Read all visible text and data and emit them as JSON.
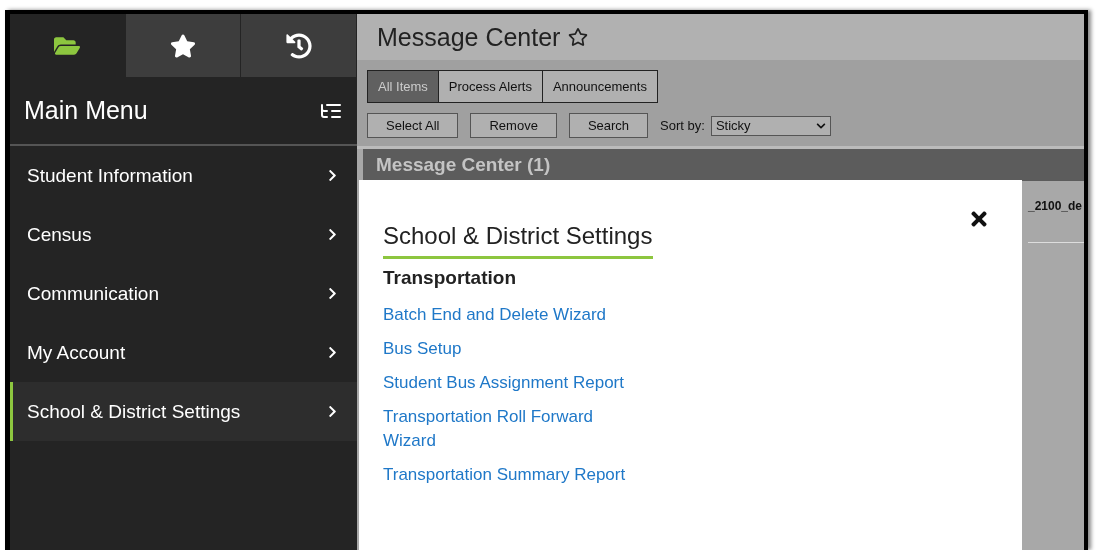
{
  "sidebar": {
    "tabs": [
      {
        "kind": "folder",
        "selected": true
      },
      {
        "kind": "star",
        "selected": false
      },
      {
        "kind": "history",
        "selected": false
      }
    ],
    "title": "Main Menu",
    "items": [
      {
        "label": "Student Information",
        "selected": false
      },
      {
        "label": "Census",
        "selected": false
      },
      {
        "label": "Communication",
        "selected": false
      },
      {
        "label": "My Account",
        "selected": false
      },
      {
        "label": "School & District Settings",
        "selected": true
      }
    ]
  },
  "main": {
    "title": "Message Center",
    "tabs": [
      {
        "label": "All Items",
        "selected": true
      },
      {
        "label": "Process Alerts",
        "selected": false
      },
      {
        "label": "Announcements",
        "selected": false
      }
    ],
    "buttons": [
      "Select All",
      "Remove",
      "Search"
    ],
    "sort_label": "Sort by:",
    "sort_value": "Sticky",
    "section_title": "Message Center (1)",
    "row_text": "_2100_de"
  },
  "popup": {
    "title": "School & District Settings",
    "heading": "Transportation",
    "links": [
      "Batch End and Delete Wizard",
      "Bus Setup",
      "Student Bus Assignment Report",
      "Transportation Roll Forward Wizard",
      "Transportation Summary Report"
    ]
  }
}
